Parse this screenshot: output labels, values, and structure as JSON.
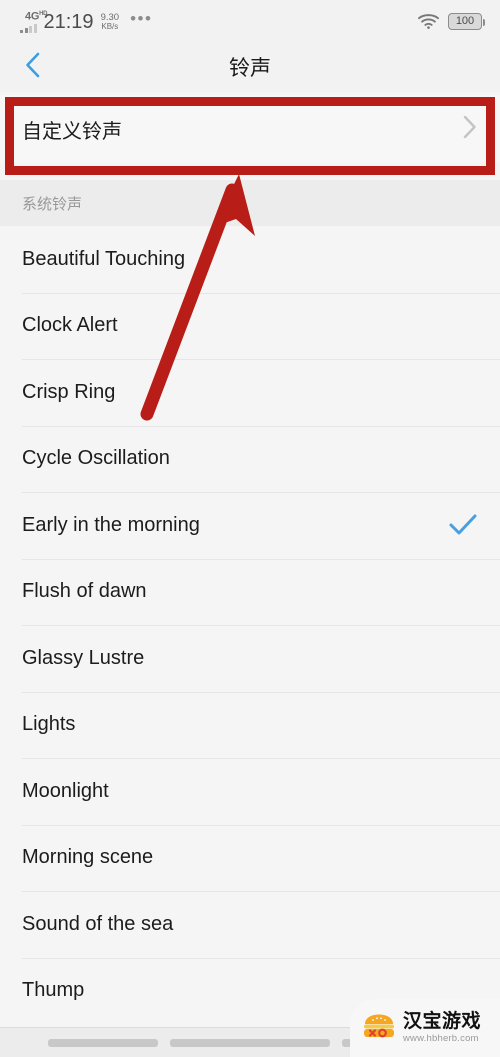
{
  "statusbar": {
    "network_type": "4G",
    "network_sup": "HD",
    "time": "21:19",
    "netspeed_value": "9.30",
    "netspeed_unit": "KB/s",
    "overflow_dots": "•••",
    "wifi_icon": "wifi-icon",
    "battery_level": "100"
  },
  "header": {
    "back_icon": "chevron-left-icon",
    "title": "铃声"
  },
  "custom": {
    "label": "自定义铃声",
    "chevron_icon": "chevron-right-icon",
    "highlight_color": "#b81d17"
  },
  "section": {
    "title": "系统铃声"
  },
  "ringtones": [
    {
      "name": "Beautiful Touching",
      "selected": false
    },
    {
      "name": "Clock Alert",
      "selected": false
    },
    {
      "name": "Crisp Ring",
      "selected": false
    },
    {
      "name": "Cycle Oscillation",
      "selected": false
    },
    {
      "name": "Early in the morning",
      "selected": true
    },
    {
      "name": "Flush of dawn",
      "selected": false
    },
    {
      "name": "Glassy Lustre",
      "selected": false
    },
    {
      "name": "Lights",
      "selected": false
    },
    {
      "name": "Moonlight",
      "selected": false
    },
    {
      "name": "Morning scene",
      "selected": false
    },
    {
      "name": "Sound of the sea",
      "selected": false
    },
    {
      "name": "Thump",
      "selected": false
    }
  ],
  "selection": {
    "check_icon": "check-icon",
    "check_color": "#4a9fe0"
  },
  "annotation": {
    "arrow_icon": "arrow-up-right-icon",
    "arrow_color": "#b81d17"
  },
  "watermark": {
    "logo_icon": "burger-logo-icon",
    "name": "汉宝游戏",
    "url": "www.hbherb.com"
  }
}
